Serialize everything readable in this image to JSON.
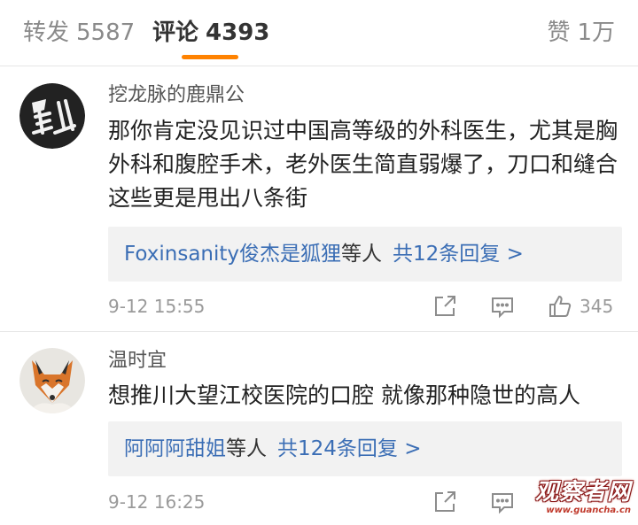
{
  "tabs": {
    "repost": {
      "label": "转发",
      "count": "5587"
    },
    "comment": {
      "label": "评论",
      "count": "4393"
    },
    "like": {
      "label": "赞",
      "count": "1万"
    }
  },
  "colors": {
    "accent": "#ff8200",
    "link": "#3b6eb5",
    "muted": "#9a9a9a"
  },
  "comments": [
    {
      "username": "挖龙脉的鹿鼎公",
      "avatar_icon": "calligraphy-avatar",
      "text": "那你肯定没见识过中国高等级的外科医生，尤其是胸外科和腹腔手术，老外医生简直弱爆了，刀口和缝合这些更是甩出八条街",
      "reply_user": "Foxinsanity俊杰是狐狸",
      "reply_suffix": "等人",
      "reply_count": "共12条回复 >",
      "time": "9-12 15:55",
      "likes": "345"
    },
    {
      "username": "温时宜",
      "avatar_icon": "fox-avatar",
      "text": "想推川大望江校医院的口腔  就像那种隐世的高人",
      "reply_user": "阿阿阿甜姐",
      "reply_suffix": "等人",
      "reply_count": "共124条回复 >",
      "time": "9-12 16:25",
      "likes": ""
    }
  ],
  "watermark": {
    "title": "观察者网",
    "url": "www.guancha.cn"
  }
}
